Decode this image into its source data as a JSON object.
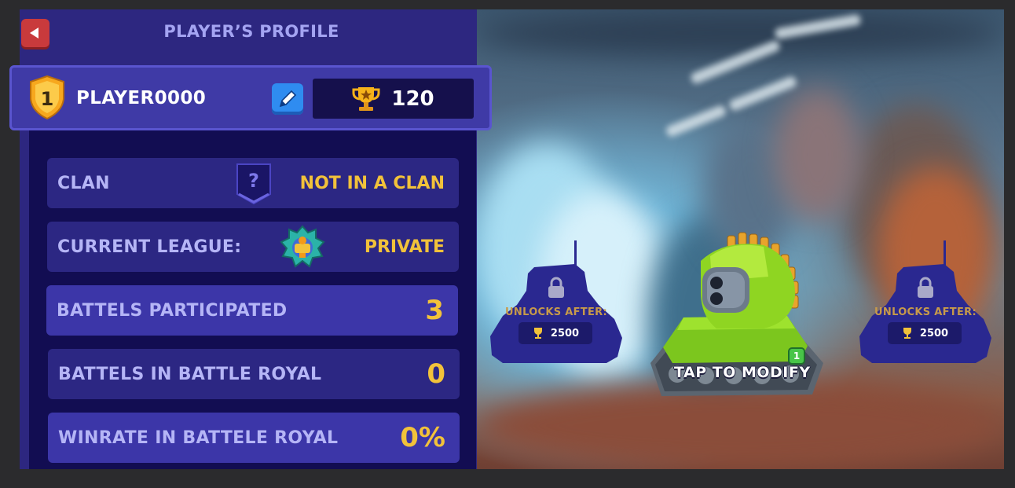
{
  "header": {
    "title": "PLAYER’S PROFILE",
    "back_icon": "back-arrow-icon"
  },
  "player": {
    "level": "1",
    "name": "PLAYER0000",
    "trophies": "120"
  },
  "stats": [
    {
      "label": "CLAN",
      "value": "NOT IN A CLAN",
      "icon": "question-shield-icon"
    },
    {
      "label": "CURRENT LEAGUE:",
      "value": "PRIVATE",
      "icon": "league-emblem-icon"
    },
    {
      "label": "BATTELS PARTICIPATED",
      "value": "3"
    },
    {
      "label": "BATTELS IN BATTLE ROYAL",
      "value": "0"
    },
    {
      "label": "WINRATE IN BATTELE ROYAL",
      "value": "0%"
    }
  ],
  "garage": {
    "left_slot": {
      "unlock_text": "UNLOCKS AFTER:",
      "trophies": "2500"
    },
    "center_tank": {
      "action": "TAP TO MODIFY",
      "level": "1"
    },
    "right_slot": {
      "unlock_text": "UNLOCKS AFTER:",
      "trophies": "2500"
    }
  },
  "colors": {
    "panel": "#2d2780",
    "accent_gold": "#f2c23a",
    "label_lavender": "#b5b5f6",
    "back_red": "#c93a3c",
    "edit_blue": "#2f8cf0"
  }
}
